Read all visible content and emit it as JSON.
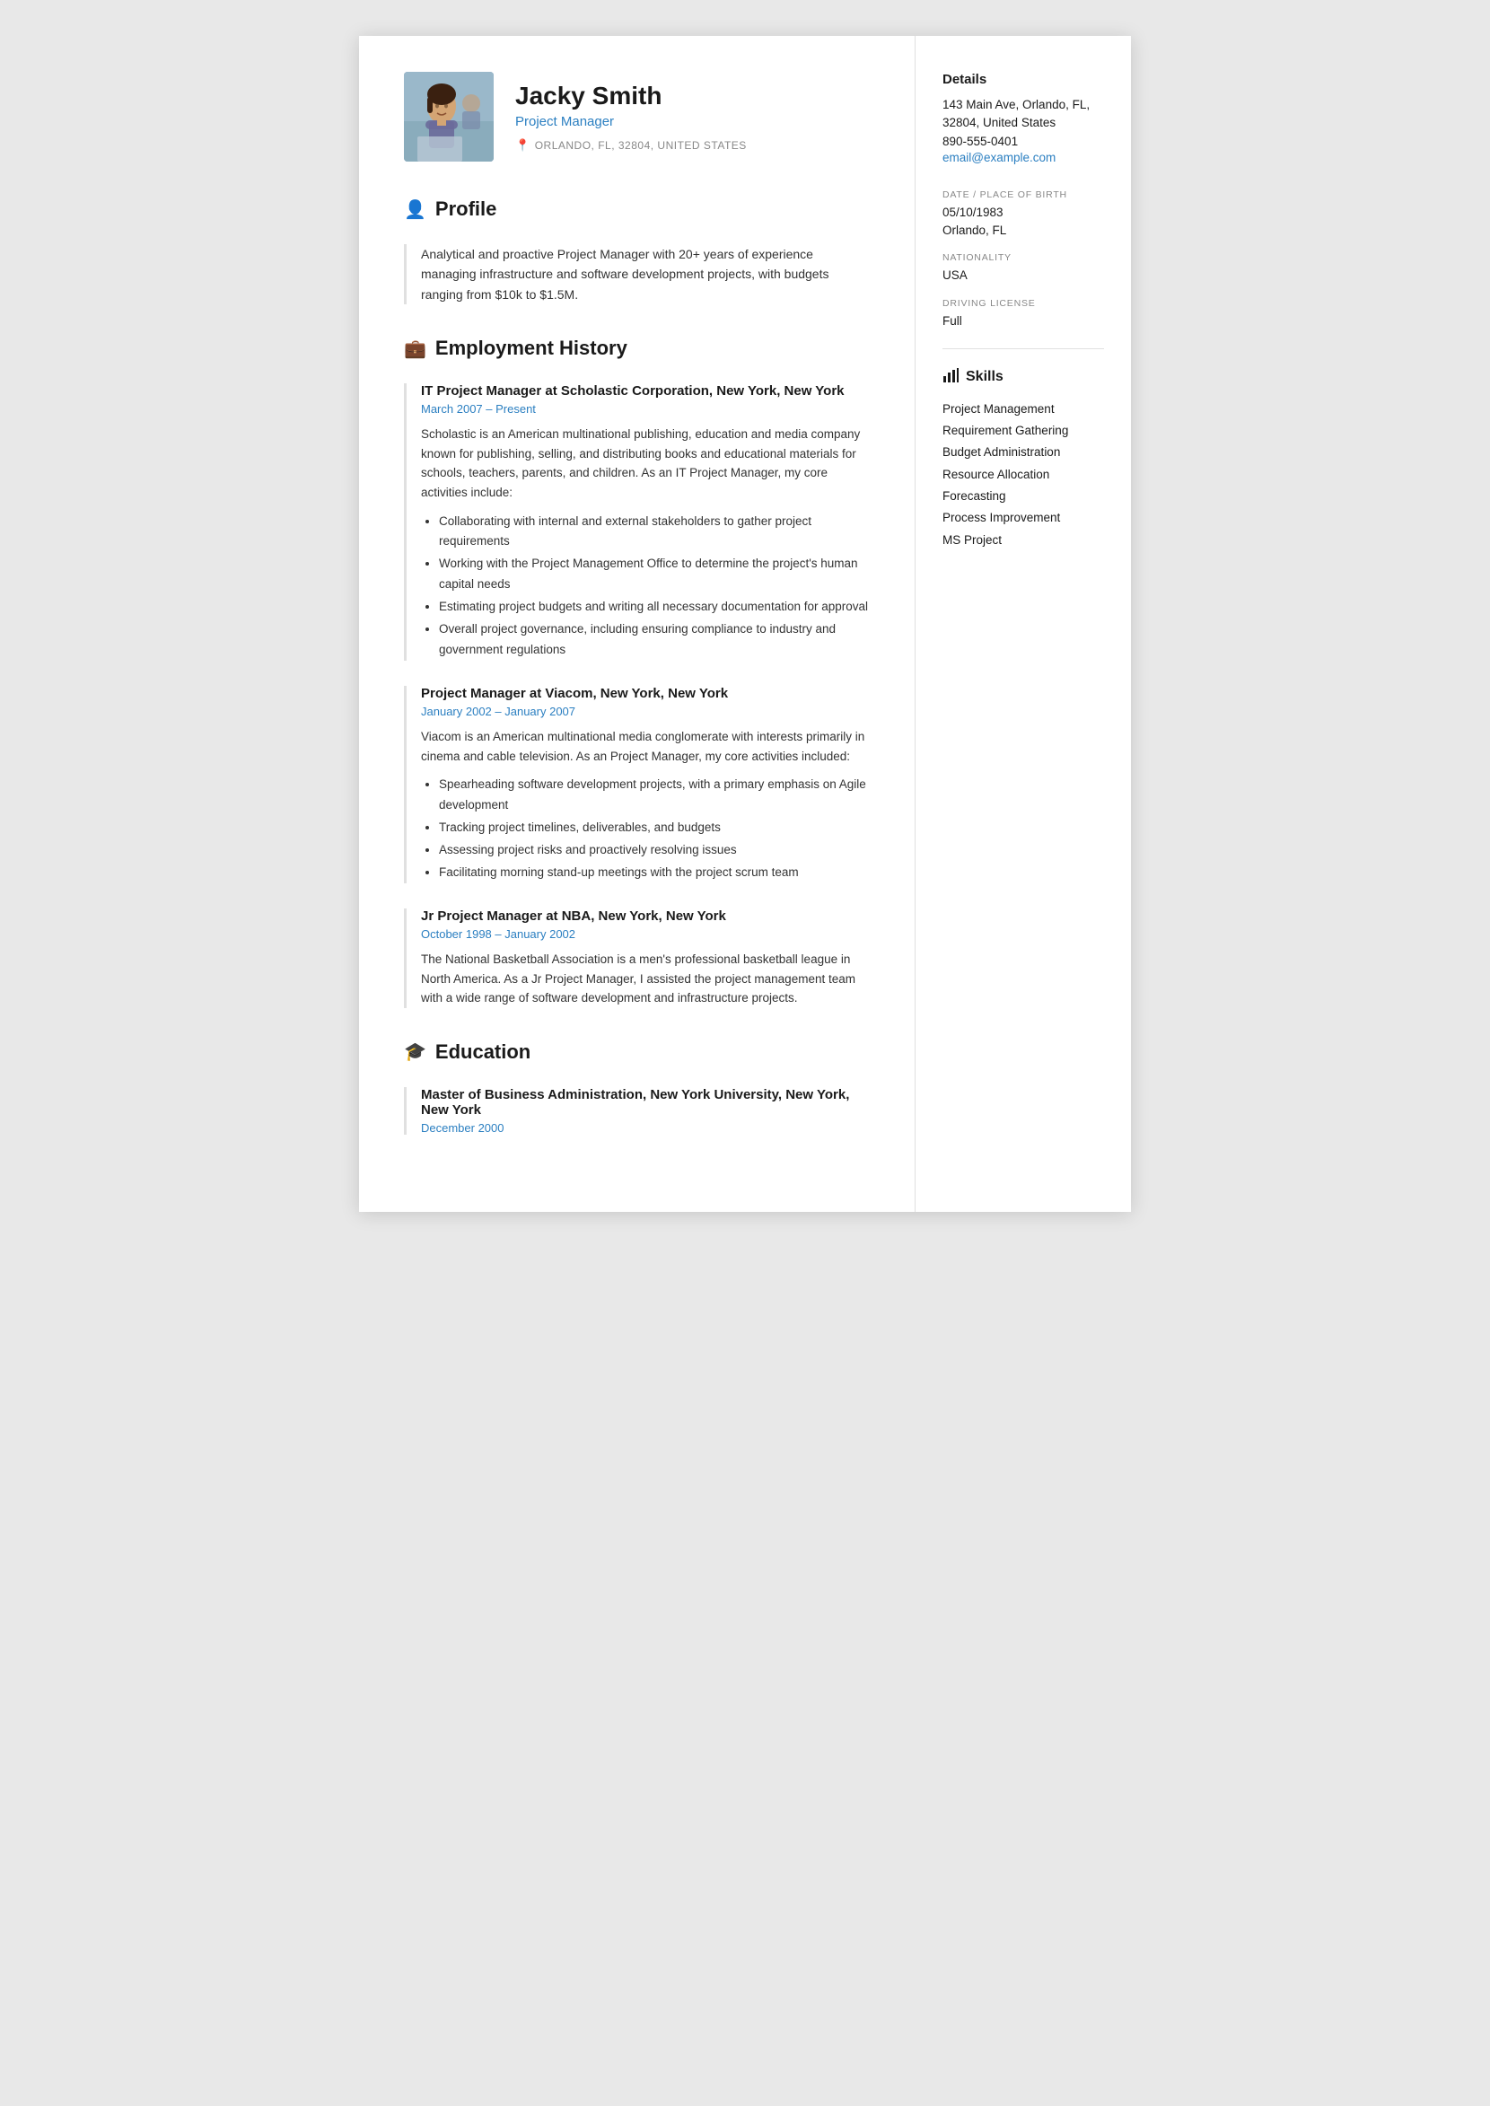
{
  "header": {
    "name": "Jacky Smith",
    "title": "Project Manager",
    "location": "ORLANDO, FL, 32804, UNITED STATES"
  },
  "sections": {
    "profile": {
      "title": "Profile",
      "icon": "👤",
      "text": "Analytical and proactive Project Manager with 20+ years of experience managing infrastructure and software development projects, with budgets ranging from $10k to $1.5M."
    },
    "employment": {
      "title": "Employment History",
      "icon": "💼",
      "jobs": [
        {
          "title": "IT Project Manager at Scholastic Corporation, New York, New York",
          "dates": "March 2007  –  Present",
          "description": "Scholastic is an American multinational publishing, education and media company known for publishing, selling, and distributing books and educational materials for schools, teachers, parents, and children. As an IT Project Manager, my core activities include:",
          "bullets": [
            "Collaborating with internal and external stakeholders to gather project requirements",
            "Working with the Project Management Office to determine the project's human capital needs",
            "Estimating project budgets and writing all necessary documentation for approval",
            "Overall project governance, including ensuring compliance to industry and government regulations"
          ]
        },
        {
          "title": "Project Manager at Viacom, New York, New York",
          "dates": "January 2002  –  January 2007",
          "description": "Viacom is an American multinational media conglomerate with interests primarily in cinema and cable television. As an Project Manager, my core activities included:",
          "bullets": [
            "Spearheading software development projects, with a primary emphasis on Agile development",
            "Tracking project timelines, deliverables, and budgets",
            "Assessing project risks and proactively resolving issues",
            "Facilitating morning stand-up meetings with the project scrum team"
          ]
        },
        {
          "title": "Jr Project Manager at NBA, New York, New York",
          "dates": "October 1998  –  January 2002",
          "description": "The National Basketball Association is a men's professional basketball league in North America. As a Jr Project Manager, I assisted the project management team with a wide range of software development and infrastructure projects.",
          "bullets": []
        }
      ]
    },
    "education": {
      "title": "Education",
      "icon": "🎓",
      "entries": [
        {
          "degree": "Master of Business Administration, New York University, New York, New York",
          "dates": "December 2000"
        }
      ]
    }
  },
  "sidebar": {
    "details_heading": "Details",
    "address": "143 Main Ave, Orlando, FL, 32804, United States",
    "phone": "890-555-0401",
    "email": "email@example.com",
    "dob_label": "DATE / PLACE OF BIRTH",
    "dob": "05/10/1983",
    "dob_place": "Orlando, FL",
    "nationality_label": "NATIONALITY",
    "nationality": "USA",
    "driving_label": "DRIVING LICENSE",
    "driving": "Full",
    "skills_heading": "Skills",
    "skills": [
      "Project Management",
      "Requirement Gathering",
      "Budget Administration",
      "Resource Allocation",
      "Forecasting",
      "Process Improvement",
      "MS Project"
    ]
  }
}
